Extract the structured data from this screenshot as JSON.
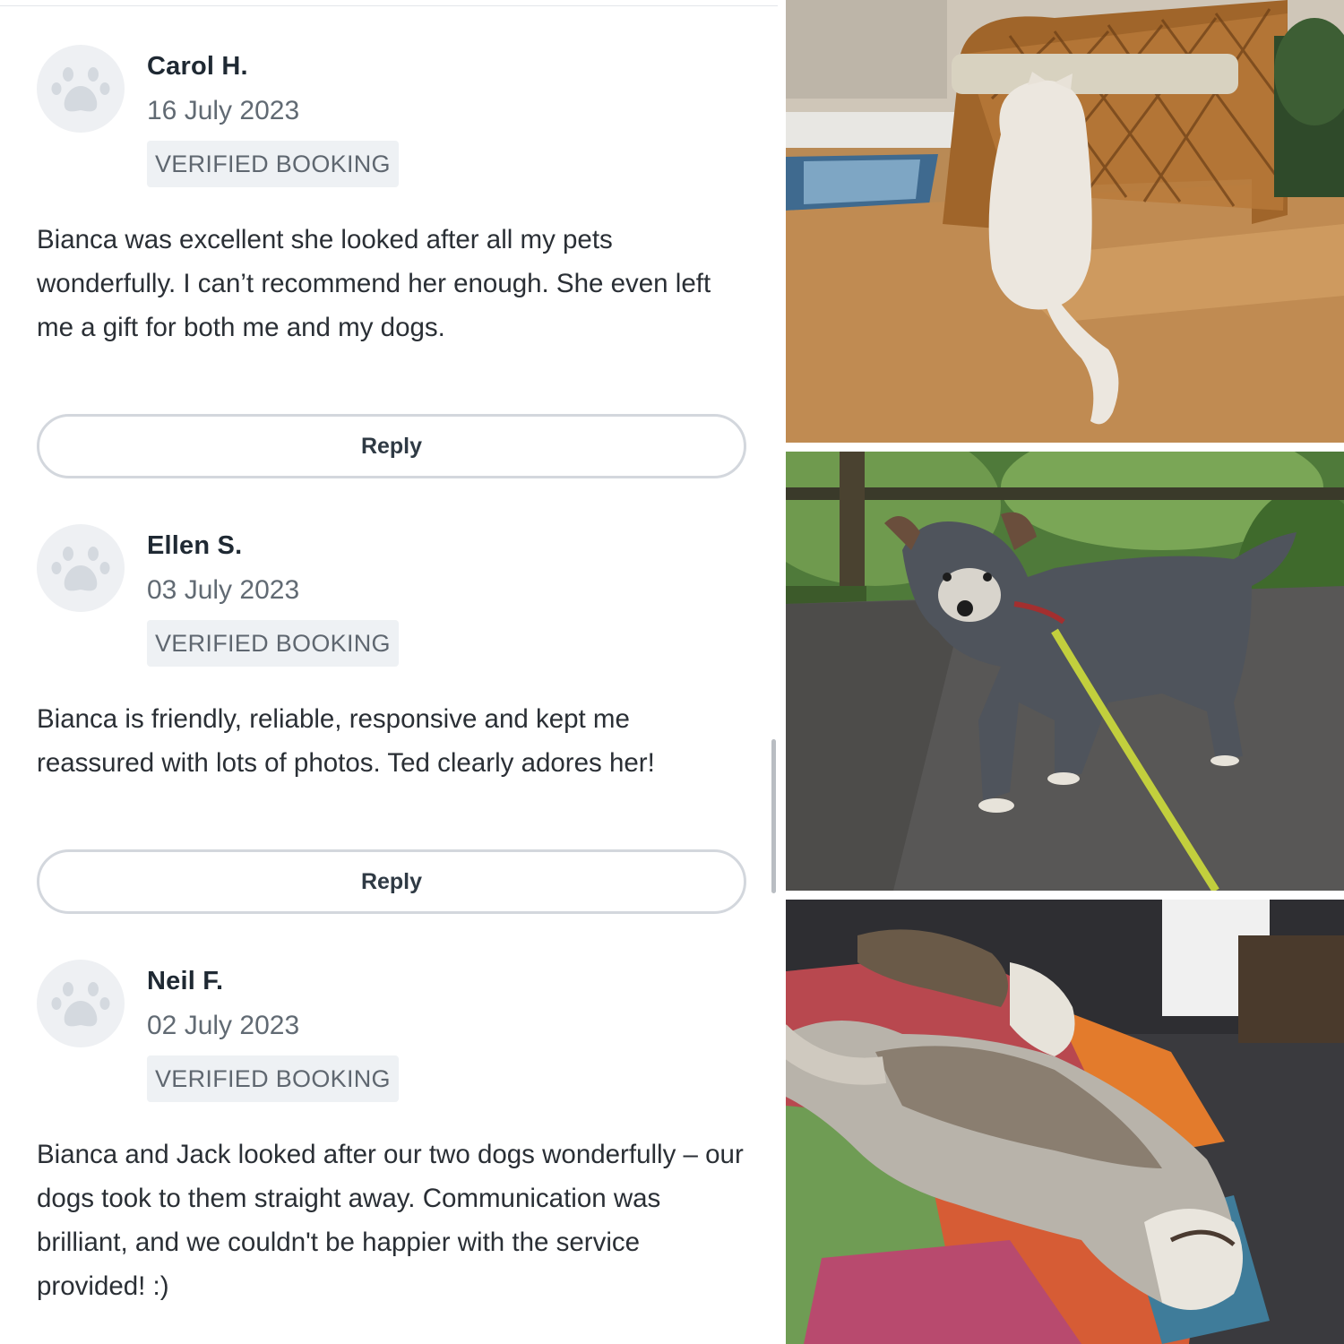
{
  "reviews": [
    {
      "reviewer": "Carol H.",
      "date": "16 July 2023",
      "badge": "VERIFIED BOOKING",
      "text": "Bianca was excellent she looked after all my pets wonderfully. I can’t recommend her enough. She even left me a gift for both me and my dogs.",
      "reply_label": "Reply",
      "avatar_icon": "paw-icon"
    },
    {
      "reviewer": "Ellen S.",
      "date": "03 July 2023",
      "badge": "VERIFIED BOOKING",
      "text": "Bianca is friendly, reliable, responsive and kept me reassured with lots of photos. Ted clearly adores her!",
      "reply_label": "Reply",
      "avatar_icon": "paw-icon"
    },
    {
      "reviewer": "Neil F.",
      "date": "02 July 2023",
      "badge": "VERIFIED BOOKING",
      "text": "Bianca and Jack looked after our two dogs wonderfully – our dogs took to them straight away. Communication was brilliant, and we couldn't be happier with the service provided! :)",
      "avatar_icon": "paw-icon"
    }
  ],
  "colors": {
    "text_primary": "#1f2933",
    "text_secondary": "#616a73",
    "badge_bg": "#eef1f4",
    "button_border": "#d3d7dd",
    "avatar_bg": "#eef0f3",
    "paw": "#d4d9df"
  }
}
